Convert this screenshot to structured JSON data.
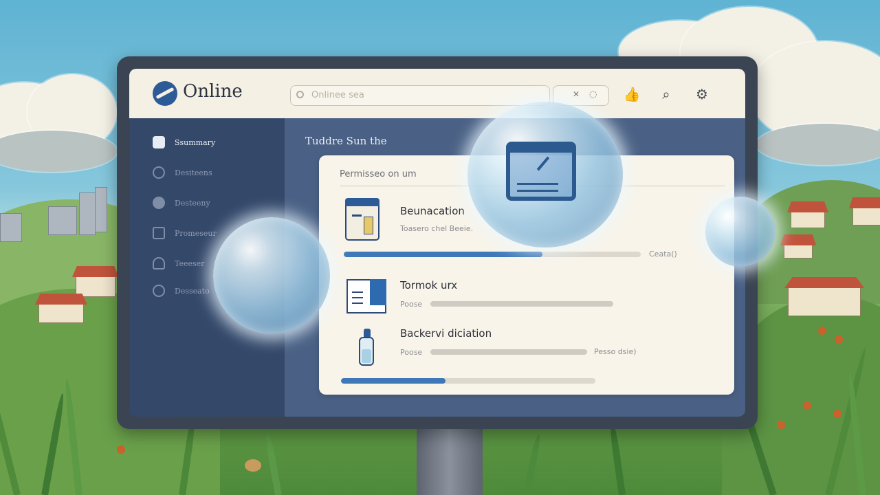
{
  "app": {
    "title": "Online",
    "search_placeholder": "Onlinee sea"
  },
  "header_icons": [
    "thumbs-up-icon",
    "search-icon",
    "settings-gear-icon"
  ],
  "sidebar": {
    "items": [
      {
        "label": "Ssummary",
        "icon": "cube-icon",
        "active": true
      },
      {
        "label": "Desiteens",
        "icon": "globe-icon",
        "active": false
      },
      {
        "label": "Desteeny",
        "icon": "circle-icon",
        "active": false
      },
      {
        "label": "Promeseur",
        "icon": "document-icon",
        "active": false
      },
      {
        "label": "Teeeser",
        "icon": "user-icon",
        "active": false
      },
      {
        "label": "Desseato",
        "icon": "ring-icon",
        "active": false
      }
    ]
  },
  "main": {
    "heading": "Tuddre Sun the",
    "card": {
      "title": "Permisseo on um",
      "rows": [
        {
          "title": "Beunacation",
          "subtitle": "Toasero chel Beeie.",
          "progress": 0.67,
          "meta": "Ceata()"
        },
        {
          "title": "Tormok urx",
          "subtitle": "Poose",
          "progress": 0.0,
          "meta": ""
        },
        {
          "title": "Backervi diciation",
          "subtitle": "Poose",
          "progress": 0.0,
          "meta": "Pesso dsie)"
        }
      ],
      "bottom_progress": 0.41
    }
  },
  "colors": {
    "accent": "#3e78b8",
    "sidebar": "#34486a",
    "header": "#f5f0e4",
    "card": "#f8f4ea"
  }
}
